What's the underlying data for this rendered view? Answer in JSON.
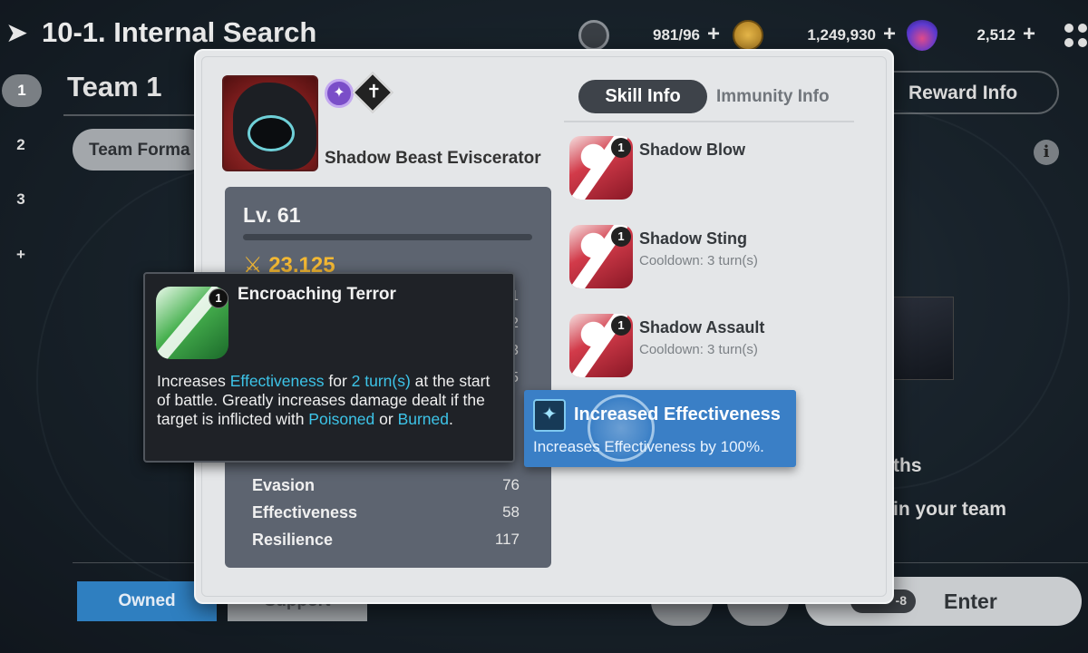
{
  "header": {
    "stage_title": "10-1. Internal Search",
    "resources": [
      {
        "icon": "stamina-gear-icon",
        "value": "981/96",
        "color": "#6c7178"
      },
      {
        "icon": "gold-coin-icon",
        "value": "1,249,930",
        "color": "#c9962a"
      },
      {
        "icon": "skystone-gem-icon",
        "value": "2,512",
        "color": "#7b4fd0"
      }
    ],
    "plus": "+"
  },
  "teams": {
    "numbers": [
      "1",
      "2",
      "3",
      "+"
    ],
    "active": "1",
    "title": "Team 1",
    "format_label": "Team Forma"
  },
  "background": {
    "reward_info": "Reward Info",
    "strengths_fragment": "ths",
    "team_fragment": "in your team",
    "owned": "Owned",
    "support": "Support",
    "enter": "Enter",
    "enter_cost": "-8"
  },
  "hero": {
    "name": "Shadow Beast Eviscerator",
    "element_icon": "dark-element-icon",
    "class_icon": "class-knight-icon",
    "level": "Lv. 61",
    "combat_power": "23,125",
    "stats": [
      {
        "name": "Evasion",
        "value": "76"
      },
      {
        "name": "Effectiveness",
        "value": "58"
      },
      {
        "name": "Resilience",
        "value": "117"
      }
    ]
  },
  "tabs": {
    "skill": "Skill Info",
    "immunity": "Immunity Info"
  },
  "skills": [
    {
      "name": "Shadow Blow",
      "cooldown": "",
      "level": "1"
    },
    {
      "name": "Shadow Sting",
      "cooldown": "Cooldown: 3 turn(s)",
      "level": "1"
    },
    {
      "name": "Shadow Assault",
      "cooldown": "Cooldown: 3 turn(s)",
      "level": "1"
    }
  ],
  "tooltip": {
    "level": "1",
    "title": "Encroaching Terror",
    "desc_1": "Increases ",
    "kw_1": "Effectiveness",
    "desc_2": " for ",
    "kw_2": "2 turn(s)",
    "desc_3": " at the start of battle. Greatly increases damage dealt if the target is inflicted with ",
    "kw_3": "Poisoned",
    "desc_4": " or ",
    "kw_4": "Burned",
    "desc_5": "."
  },
  "buff_tooltip": {
    "title": "Increased Effectiveness",
    "desc": "Increases Effectiveness by 100%.",
    "icon": "effectiveness-buff-icon"
  }
}
